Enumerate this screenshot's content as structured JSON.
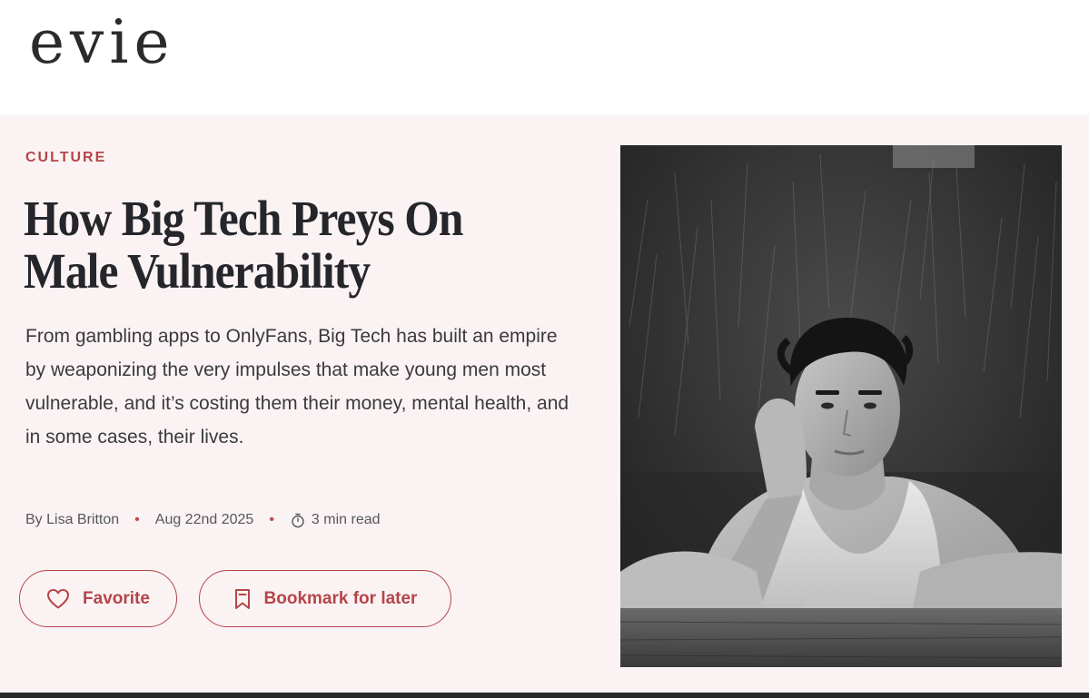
{
  "header": {
    "logo_text": "evie"
  },
  "article": {
    "category": "CULTURE",
    "title_line1": "How Big Tech Preys On",
    "title_line2": "Male Vulnerability",
    "dek": "From gambling apps to OnlyFans, Big Tech has built an empire by weaponizing the very impulses that make young men most vulnerable, and it’s costing them their money, mental health, and in some cases, their lives.",
    "byline": "By Lisa Britton",
    "date": "Aug 22nd 2025",
    "read_time": "3 min read",
    "meta_separator": "•"
  },
  "actions": {
    "favorite_label": "Favorite",
    "favorite_icon": "heart-icon",
    "bookmark_label": "Bookmark for later",
    "bookmark_icon": "bookmark-icon"
  },
  "hero_image": {
    "alt": "Black and white portrait of a man in a tank top leaning on a wooden fence, resting his cheek on his hand"
  },
  "colors": {
    "accent": "#b4454a",
    "hero_background": "#fbf3f3",
    "title_text": "#25262b"
  }
}
